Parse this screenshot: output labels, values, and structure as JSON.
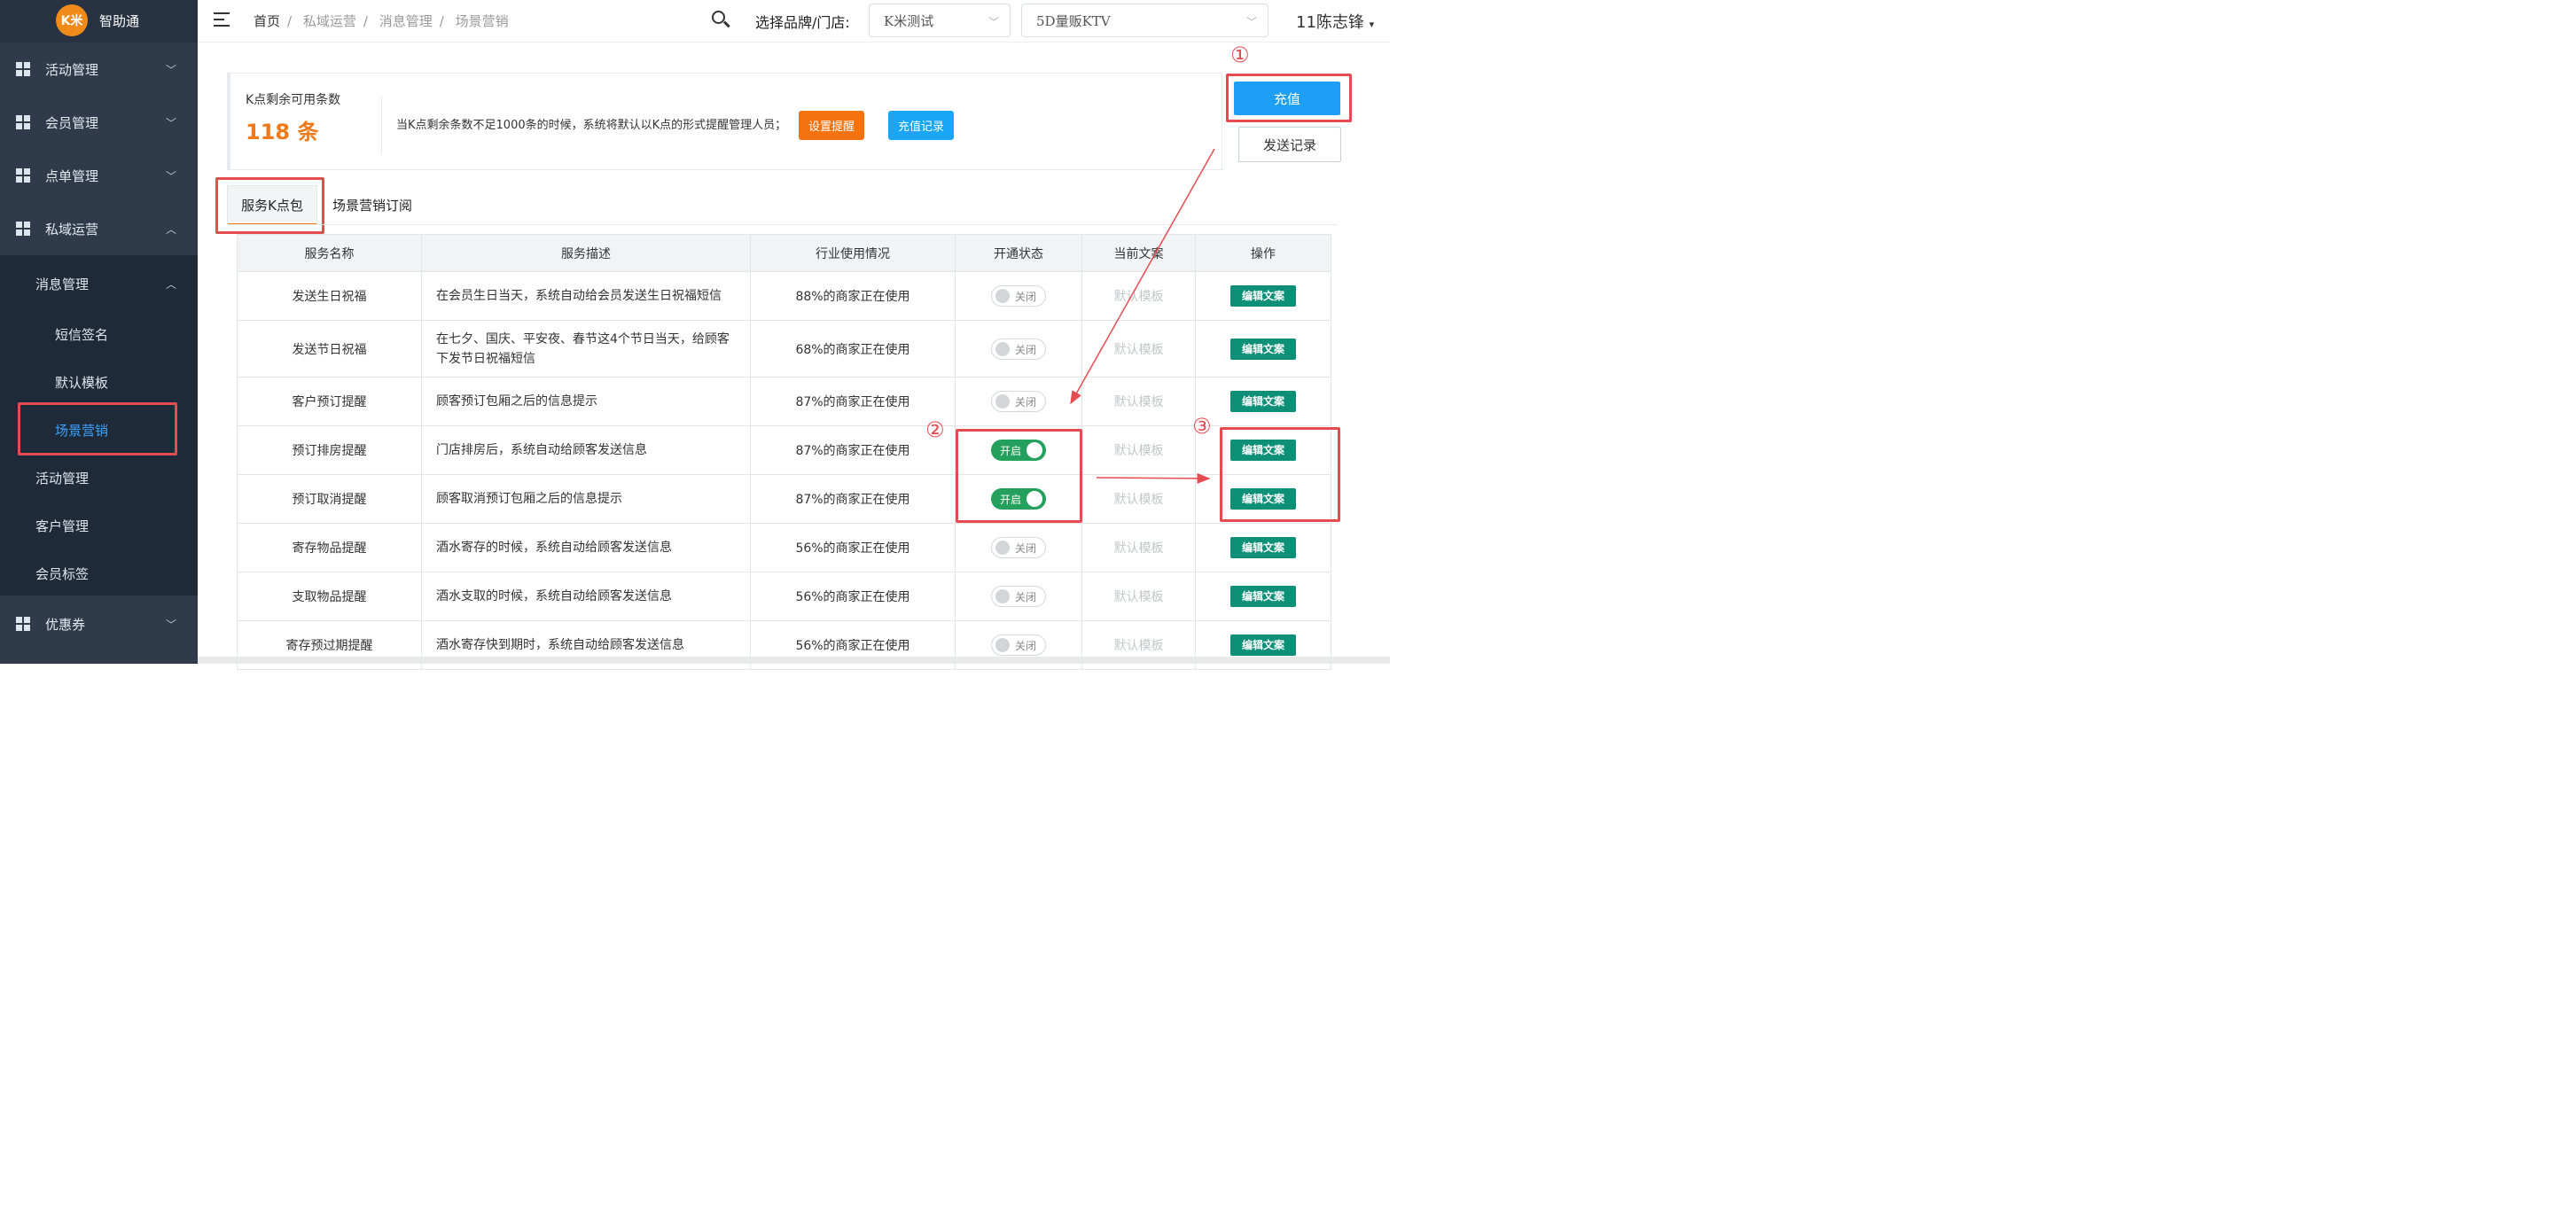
{
  "sidebar": {
    "brand": {
      "logo_text": "K米",
      "name": "智助通"
    },
    "menus": [
      {
        "label": "活动管理",
        "expanded": false
      },
      {
        "label": "会员管理",
        "expanded": false
      },
      {
        "label": "点单管理",
        "expanded": false
      },
      {
        "label": "私域运营",
        "expanded": true
      }
    ],
    "submenu": {
      "msg_mgmt": "消息管理",
      "sms_sign": "短信签名",
      "default_tpl": "默认模板",
      "scene_marketing": "场景营销",
      "activity_mgmt": "活动管理",
      "customer_mgmt": "客户管理",
      "member_tags": "会员标签"
    },
    "coupon": "优惠券"
  },
  "header": {
    "breadcrumbs": [
      "首页",
      "私域运营",
      "消息管理",
      "场景营销"
    ],
    "store_label": "选择品牌/门店:",
    "brand_select": "K米测试",
    "store_select": "5D量贩KTV",
    "user": "11陈志锋"
  },
  "kpoint": {
    "title": "K点剩余可用条数",
    "count": "118 条",
    "notice": "当K点剩余条数不足1000条的时候，系统将默认以K点的形式提醒管理人员；",
    "remind_btn": "设置提醒",
    "recharge_log_btn": "充值记录"
  },
  "actions": {
    "recharge": "充值",
    "send_log": "发送记录"
  },
  "annotations": {
    "n1": "①",
    "n2": "②",
    "n3": "③"
  },
  "tabs": [
    "服务K点包",
    "场景营销订阅"
  ],
  "table": {
    "headers": [
      "服务名称",
      "服务描述",
      "行业使用情况",
      "开通状态",
      "当前文案",
      "操作"
    ],
    "on_label": "开启",
    "off_label": "关闭",
    "rows": [
      {
        "name": "发送生日祝福",
        "desc": "在会员生日当天，系统自动给会员发送生日祝福短信",
        "usage": "88%的商家正在使用",
        "status": "关闭",
        "tpl": "默认模板",
        "op": "编辑文案"
      },
      {
        "name": "发送节日祝福",
        "desc": "在七夕、国庆、平安夜、春节这4个节日当天，给顾客下发节日祝福短信",
        "usage": "68%的商家正在使用",
        "status": "关闭",
        "tpl": "默认模板",
        "op": "编辑文案"
      },
      {
        "name": "客户预订提醒",
        "desc": "顾客预订包厢之后的信息提示",
        "usage": "87%的商家正在使用",
        "status": "关闭",
        "tpl": "默认模板",
        "op": "编辑文案"
      },
      {
        "name": "预订排房提醒",
        "desc": "门店排房后，系统自动给顾客发送信息",
        "usage": "87%的商家正在使用",
        "status": "开启",
        "tpl": "默认模板",
        "op": "编辑文案"
      },
      {
        "name": "预订取消提醒",
        "desc": "顾客取消预订包厢之后的信息提示",
        "usage": "87%的商家正在使用",
        "status": "开启",
        "tpl": "默认模板",
        "op": "编辑文案"
      },
      {
        "name": "寄存物品提醒",
        "desc": "酒水寄存的时候，系统自动给顾客发送信息",
        "usage": "56%的商家正在使用",
        "status": "关闭",
        "tpl": "默认模板",
        "op": "编辑文案"
      },
      {
        "name": "支取物品提醒",
        "desc": "酒水支取的时候，系统自动给顾客发送信息",
        "usage": "56%的商家正在使用",
        "status": "关闭",
        "tpl": "默认模板",
        "op": "编辑文案"
      },
      {
        "name": "寄存预过期提醒",
        "desc": "酒水寄存快到期时，系统自动给顾客发送信息",
        "usage": "56%的商家正在使用",
        "status": "关闭",
        "tpl": "默认模板",
        "op": "编辑文案"
      }
    ]
  },
  "colors": {
    "sidebar": "#2f3b4b",
    "accent_orange": "#f07a1a",
    "primary_blue": "#1d9ff5",
    "switch_on": "#22a05c",
    "edit_btn": "#0d8f78",
    "annotation_red": "#e64b52"
  }
}
